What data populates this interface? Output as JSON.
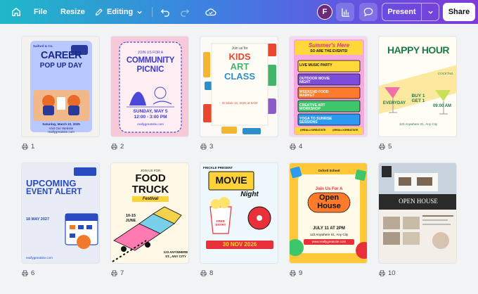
{
  "toolbar": {
    "file": "File",
    "resize": "Resize",
    "editing": "Editing",
    "avatar_initial": "F",
    "present": "Present",
    "share": "Share"
  },
  "pages": [
    {
      "number": "1",
      "lines": [
        "Saiford & Co.",
        "CAREER",
        "POP UP DAY",
        "Saturday, March 22, 2025",
        "Visit Our Website",
        "reallygreatsite.com"
      ]
    },
    {
      "number": "2",
      "lines": [
        "JOIN US FOR A",
        "COMMUNITY",
        "PICNIC",
        "SUNDAY, MAY 5",
        "12:00 - 3:00 PM",
        "reallygreatsite.com"
      ]
    },
    {
      "number": "3",
      "lines": [
        "Join us for",
        "KIDS",
        "ART",
        "CLASS",
        "October 12, 2025 at 9AM"
      ]
    },
    {
      "number": "4",
      "lines": [
        "Summer's Here",
        "SO ARE THE EVENTS!",
        "LIVE MUSIC PARTY",
        "OUTDOOR MOVIE NIGHT",
        "WEEKEND FOOD MARKET",
        "CREATIVE ART WORKSHOP",
        "YOGA TO SUNRISE SESSIONS",
        "@REALLYGREATSITE",
        "@REALLYGREATSITE"
      ]
    },
    {
      "number": "5",
      "lines": [
        "HAPPY HOUR",
        "COCKTAIL",
        "EVERYDAY",
        "BUY 1 GET 1",
        "09:00 AM",
        "123 Anywhere St., Any City"
      ]
    },
    {
      "number": "6",
      "lines": [
        "UPCOMING",
        "EVENT ALERT",
        "18 MAY 2027",
        "reallygreatsite.com"
      ]
    },
    {
      "number": "7",
      "lines": [
        "JOIN US FOR",
        "FOOD",
        "TRUCK",
        "Festival",
        "10-15 JUNE",
        "123 ANYWHERE ST., ANY CITY"
      ]
    },
    {
      "number": "8",
      "lines": [
        "FINCKLE PRESENT",
        "MOVIE",
        "Night",
        "FREE ENTRY",
        "30 NOV 2026"
      ]
    },
    {
      "number": "9",
      "lines": [
        "Oxford School",
        "Join Us For A",
        "Open",
        "House",
        "JULY 11 AT 2PM",
        "123 Anywhere St., Any City",
        "www.reallygreatsite.com"
      ]
    },
    {
      "number": "10",
      "lines": [
        "OPEN HOUSE"
      ]
    }
  ]
}
